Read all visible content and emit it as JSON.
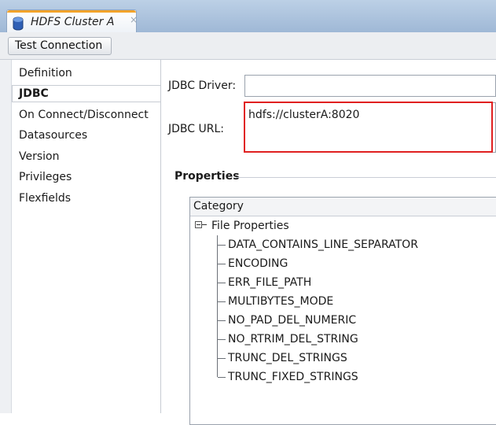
{
  "tab": {
    "title": "HDFS Cluster A",
    "close_glyph": "×",
    "icon": "database-icon"
  },
  "toolbar": {
    "test_connection_label": "Test Connection"
  },
  "nav": {
    "items": [
      {
        "label": "Definition",
        "selected": false
      },
      {
        "label": "JDBC",
        "selected": true
      },
      {
        "label": "On Connect/Disconnect",
        "selected": false
      },
      {
        "label": "Datasources",
        "selected": false
      },
      {
        "label": "Version",
        "selected": false
      },
      {
        "label": "Privileges",
        "selected": false
      },
      {
        "label": "Flexfields",
        "selected": false
      }
    ]
  },
  "jdbc": {
    "driver_label": "JDBC Driver:",
    "driver_value": "",
    "url_label": "JDBC URL:",
    "url_value": "hdfs://clusterA:8020"
  },
  "properties": {
    "header": "Properties",
    "column_header": "Category",
    "root": "File Properties",
    "children": [
      "DATA_CONTAINS_LINE_SEPARATOR",
      "ENCODING",
      "ERR_FILE_PATH",
      "MULTIBYTES_MODE",
      "NO_PAD_DEL_NUMERIC",
      "NO_RTRIM_DEL_STRING",
      "TRUNC_DEL_STRINGS",
      "TRUNC_FIXED_STRINGS"
    ]
  },
  "colors": {
    "highlight": "#e02020",
    "tab_accent": "#f2a32a"
  }
}
